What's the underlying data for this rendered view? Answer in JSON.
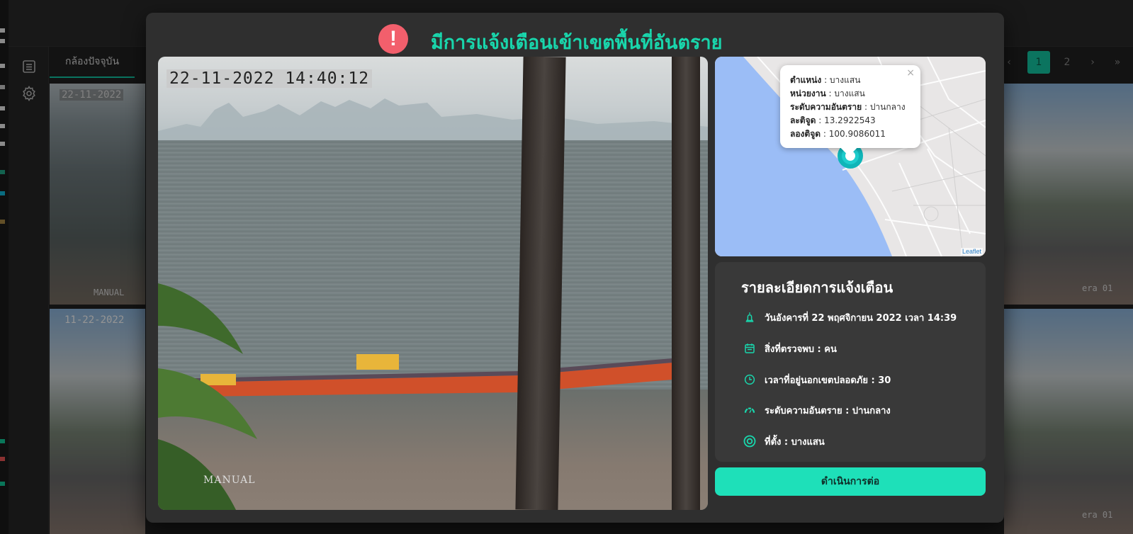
{
  "background": {
    "tab_current_camera": "กล้องปัจจุบัน",
    "pagination": {
      "prev": "‹",
      "pages": [
        "1",
        "2"
      ],
      "active_page": "1",
      "next": "›",
      "last": "»"
    },
    "cameras": [
      {
        "timestamp": "22-11-2022",
        "mode": "MANUAL"
      },
      {
        "timestamp": "11-22-2022",
        "mode": ""
      },
      {
        "timestamp": "",
        "mode": "era 01"
      },
      {
        "timestamp": "",
        "mode": "era 01"
      }
    ]
  },
  "alert": {
    "icon": "exclamation-icon",
    "title": "มีการแจ้งเตือนเข้าเขตพื้นที่อันตราย"
  },
  "video": {
    "timestamp": "22-11-2022 14:40:12",
    "mode": "MANUAL"
  },
  "map": {
    "popup": {
      "position_label": "ตำแหน่ง",
      "position_value": "บางแสน",
      "unit_label": "หน่วยงาน",
      "unit_value": "บางแสน",
      "danger_label": "ระดับความอันตราย",
      "danger_value": "ปานกลาง",
      "lat_label": "ละติจูด",
      "lat_value": "13.2922543",
      "lng_label": "ลองติจูด",
      "lng_value": "100.9086011",
      "close": "×"
    },
    "attribution": "Leaflet",
    "colors": {
      "water": "#9bbdf6",
      "land": "#e8e6e6",
      "marker": "#1ecdcd"
    }
  },
  "details": {
    "title": "รายละเอียดการแจ้งเตือน",
    "rows": [
      {
        "icon": "bell-icon",
        "text": "วันอังคารที่ 22 พฤศจิกายน 2022 เวลา 14:39"
      },
      {
        "icon": "calendar-icon",
        "text": "สิ่งที่ตรวจพบ : คน"
      },
      {
        "icon": "clock-icon",
        "text": "เวลาที่อยู่นอกเขตปลอดภัย : 30"
      },
      {
        "icon": "gauge-icon",
        "text": "ระดับความอันตราย : ปานกลาง"
      },
      {
        "icon": "location-target-icon",
        "text": "ที่ตั้ง : บางแสน"
      }
    ]
  },
  "actions": {
    "continue_label": "ดำเนินการต่อ"
  },
  "colors": {
    "accent": "#19d6ac",
    "button": "#1ee0b9",
    "alert_red": "#f25f6c",
    "modal_bg": "#2f2f2f",
    "panel_bg": "#393939"
  }
}
